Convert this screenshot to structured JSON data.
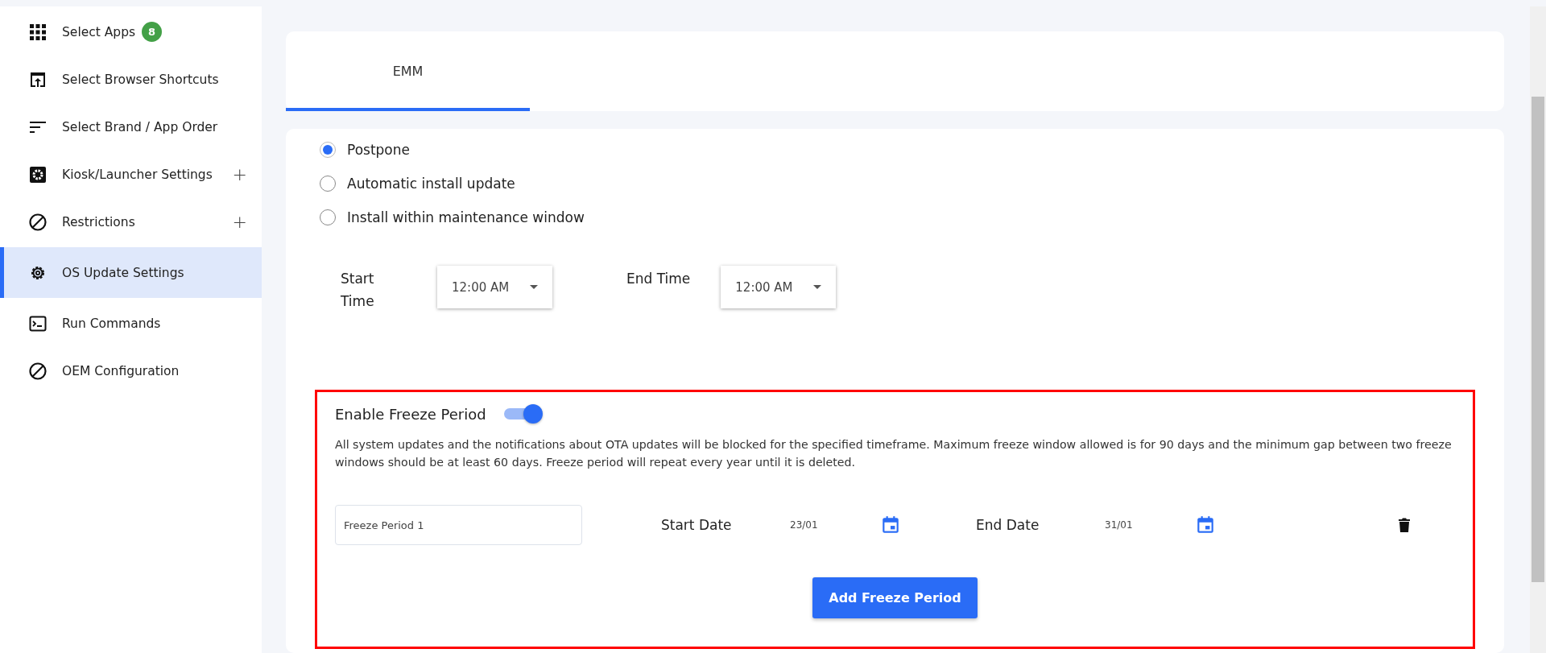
{
  "sidebar": {
    "items": [
      {
        "label": "Select Apps",
        "kind": "grid",
        "badge": "8",
        "selected": false
      },
      {
        "label": "Select Browser Shortcuts",
        "kind": "upload",
        "selected": false
      },
      {
        "label": "Select Brand / App Order",
        "kind": "sort",
        "selected": false
      },
      {
        "label": "Kiosk/Launcher Settings",
        "kind": "gearbox",
        "expand_symbol": "+",
        "selected": false
      },
      {
        "label": "Restrictions",
        "kind": "block",
        "expand_symbol": "+",
        "selected": false
      },
      {
        "label": "OS Update Settings",
        "kind": "gear",
        "selected": true
      },
      {
        "label": "Run Commands",
        "kind": "terminal",
        "selected": false
      },
      {
        "label": "OEM Configuration",
        "kind": "block",
        "selected": false
      }
    ]
  },
  "tabs": [
    {
      "label": "EMM",
      "selected": true
    }
  ],
  "update_policy": {
    "options": [
      {
        "label": "Postpone",
        "selected": true
      },
      {
        "label": "Automatic install update",
        "selected": false
      },
      {
        "label": "Install within maintenance window",
        "selected": false
      }
    ],
    "start_time": {
      "label": "Start Time",
      "value": "12:00 AM"
    },
    "end_time": {
      "label": "End Time",
      "value": "12:00 AM"
    }
  },
  "freeze": {
    "title": "Enable Freeze Period",
    "on": true,
    "description": "All system updates and the notifications about OTA updates will be blocked for the specified timeframe. Maximum freeze window allowed is for 90 days and the minimum gap between two freeze windows should be at least 60 days. Freeze period will repeat every year until it is deleted.",
    "periods": [
      {
        "name": "Freeze Period 1",
        "start_label": "Start Date",
        "start": "23/01",
        "end_label": "End Date",
        "end": "31/01"
      }
    ],
    "add_button": "Add Freeze Period"
  }
}
